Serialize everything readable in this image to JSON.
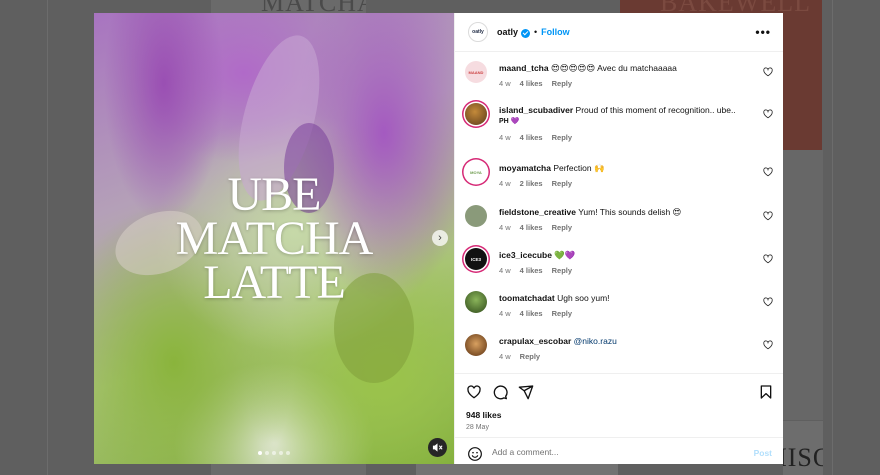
{
  "background": {
    "tiles": [
      "MATCHA",
      "BAKEWELL",
      "MAPLE MISO"
    ]
  },
  "post": {
    "media": {
      "title_lines": [
        "UBE",
        "MATCHA",
        "LATTE"
      ],
      "carousel_dots": 5,
      "active_dot": 0,
      "next_icon": "chevron-right-icon",
      "mute_icon": "speaker-muted-icon"
    },
    "header": {
      "logo_text": "oatly",
      "username": "oatly",
      "separator": "•",
      "follow_label": "Follow",
      "more_label": "•••"
    },
    "comments": [
      {
        "user": "maand_tcha",
        "text": " 😍😍😍😍😍 Avec du matchaaaaa",
        "time": "4 w",
        "likes": "4 likes",
        "reply": "Reply",
        "avatar_label": "MAAND"
      },
      {
        "user": "island_scubadiver",
        "text": " Proud of this moment of recognition.. ube..",
        "text2": "PH 💜",
        "time": "4 w",
        "likes": "4 likes",
        "reply": "Reply"
      },
      {
        "user": "moyamatcha",
        "text": " Perfection 🙌",
        "time": "4 w",
        "likes": "2 likes",
        "reply": "Reply",
        "avatar_label": "MOYA"
      },
      {
        "user": "fieldstone_creative",
        "text": " Yum! This sounds delish 😍",
        "time": "4 w",
        "likes": "4 likes",
        "reply": "Reply"
      },
      {
        "user": "ice3_icecube",
        "text": " 💚💜",
        "time": "4 w",
        "likes": "4 likes",
        "reply": "Reply",
        "avatar_label": "ICE3"
      },
      {
        "user": "toomatchadat",
        "text": " Ugh soo yum!",
        "time": "4 w",
        "likes": "4 likes",
        "reply": "Reply"
      },
      {
        "user": "crapulax_escobar",
        "mention": "@niko.razu",
        "text": " ",
        "time": "4 w",
        "reply": "Reply"
      }
    ],
    "likes_count": "948 likes",
    "date": "28 May",
    "add_comment": {
      "placeholder": "Add a comment...",
      "post_label": "Post"
    },
    "colors": {
      "accent": "#0095f6",
      "story_ring": "#d62976",
      "post_disabled": "#b2dffc"
    }
  }
}
